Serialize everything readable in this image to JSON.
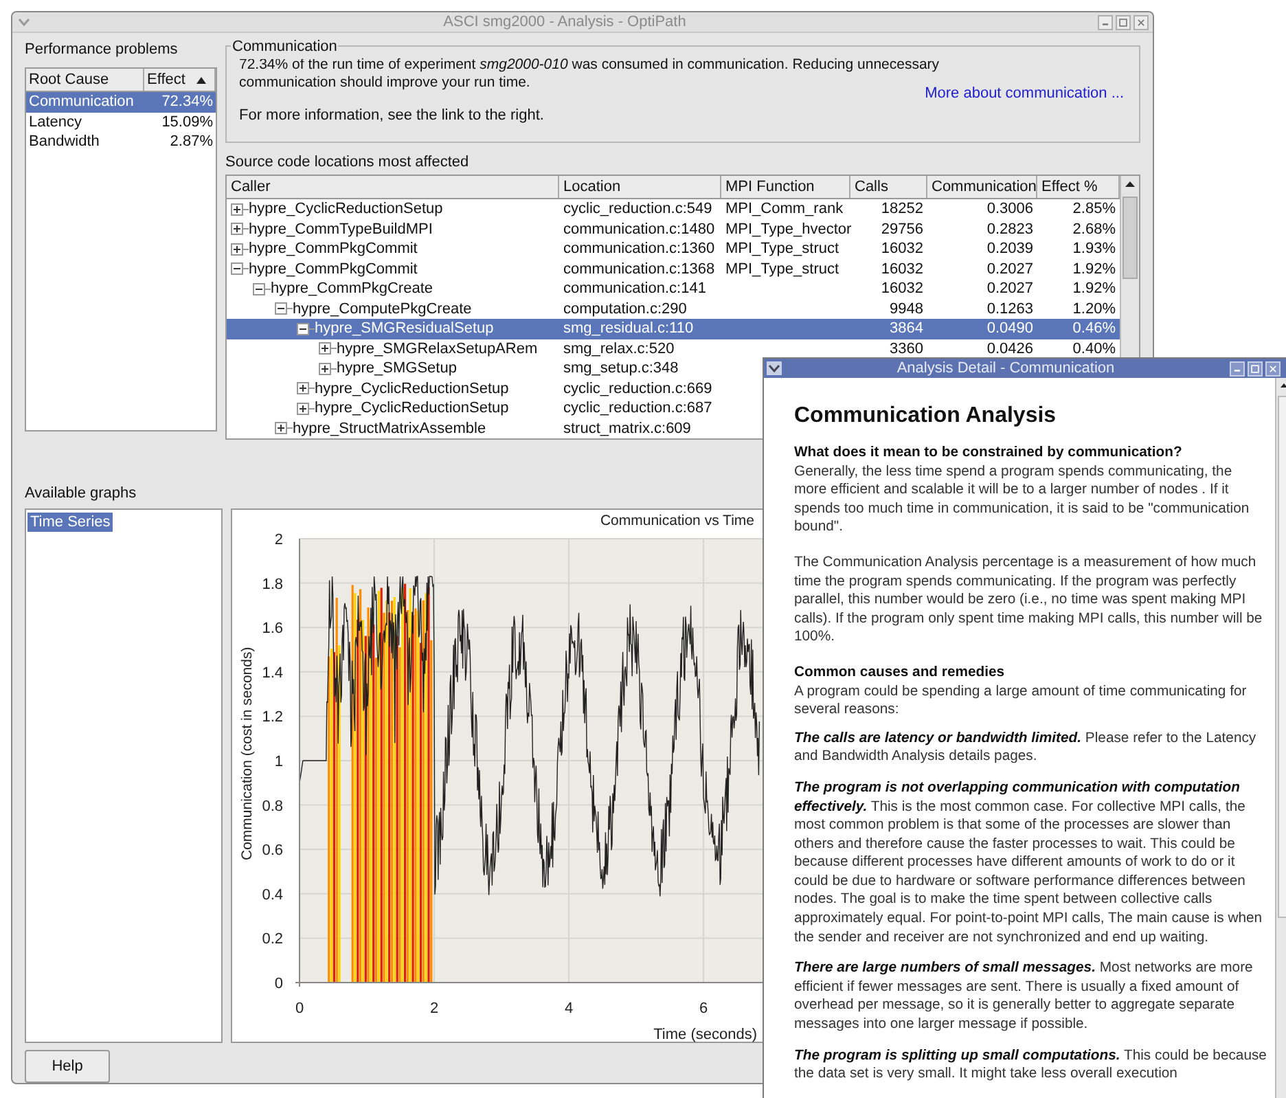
{
  "window": {
    "title": "ASCI smg2000 - Analysis - OptiPath"
  },
  "problems": {
    "title": "Performance problems",
    "columns": [
      {
        "label": "Root Cause",
        "sorted": false
      },
      {
        "label": "Effect",
        "sorted": true
      }
    ],
    "rows": [
      {
        "cause": "Communication",
        "effect": "72.34%",
        "selected": true
      },
      {
        "cause": "Latency",
        "effect": "15.09%",
        "selected": false
      },
      {
        "cause": "Bandwidth",
        "effect": "2.87%",
        "selected": false
      }
    ]
  },
  "summary": {
    "title": "Communication",
    "text": "72.34% of the run time of experiment *smg2000-010* was consumed in communication. Reducing unnecessary communication should improve your run time.",
    "note": "For more information, see the link to the right.",
    "link": "More about communication ..."
  },
  "locations": {
    "title": "Source code locations most affected",
    "columns": [
      "Caller",
      "Location",
      "MPI Function",
      "Calls",
      "Communication",
      "Effect %"
    ],
    "rows": [
      {
        "caller": "hypre_CyclicReductionSetup",
        "location": "cyclic_reduction.c:549",
        "mpi_function": "MPI_Comm_rank",
        "calls": "18252",
        "communication": "0.3006",
        "effect": "2.85%",
        "expanded": false,
        "selected": false
      },
      {
        "caller": "hypre_CommTypeBuildMPI",
        "location": "communication.c:1480",
        "mpi_function": "MPI_Type_hvector",
        "calls": "29756",
        "communication": "0.2823",
        "effect": "2.68%",
        "expanded": false,
        "selected": false
      },
      {
        "caller": "hypre_CommPkgCommit",
        "location": "communication.c:1360",
        "mpi_function": "MPI_Type_struct",
        "calls": "16032",
        "communication": "0.2039",
        "effect": "1.93%",
        "expanded": false,
        "selected": false
      },
      {
        "caller": "hypre_CommPkgCommit",
        "location": "communication.c:1368",
        "mpi_function": "MPI_Type_struct",
        "calls": "16032",
        "communication": "0.2027",
        "effect": "1.92%",
        "expanded": true,
        "selected": false,
        "children": [
          {
            "caller": "hypre_CommPkgCreate",
            "location": "communication.c:141",
            "calls": "16032",
            "communication": "0.2027",
            "effect": "1.92%",
            "expanded": true,
            "selected": false,
            "children": [
              {
                "caller": "hypre_ComputePkgCreate",
                "location": "computation.c:290",
                "calls": "9948",
                "communication": "0.1263",
                "effect": "1.20%",
                "expanded": true,
                "selected": false,
                "children": [
                  {
                    "caller": "hypre_SMGResidualSetup",
                    "location": "smg_residual.c:110",
                    "calls": "3864",
                    "communication": "0.0490",
                    "effect": "0.46%",
                    "expanded": true,
                    "selected": true,
                    "children": [
                      {
                        "caller": "hypre_SMGRelaxSetupARem",
                        "location": "smg_relax.c:520",
                        "calls": "3360",
                        "communication": "0.0426",
                        "effect": "0.40%",
                        "expanded": false,
                        "selected": false
                      },
                      {
                        "caller": "hypre_SMGSetup",
                        "location": "smg_setup.c:348",
                        "expanded": false,
                        "selected": false
                      }
                    ]
                  },
                  {
                    "caller": "hypre_CyclicReductionSetup",
                    "location": "cyclic_reduction.c:669",
                    "expanded": false,
                    "selected": false
                  },
                  {
                    "caller": "hypre_CyclicReductionSetup",
                    "location": "cyclic_reduction.c:687",
                    "expanded": false,
                    "selected": false
                  }
                ]
              },
              {
                "caller": "hypre_StructMatrixAssemble",
                "location": "struct_matrix.c:609",
                "expanded": false,
                "selected": false
              }
            ]
          }
        ]
      }
    ]
  },
  "graphs": {
    "title": "Available graphs",
    "items": [
      {
        "label": "Time Series",
        "selected": true
      }
    ]
  },
  "chart": {
    "title": "Communication vs Time",
    "ylabel": "Communication (cost in seconds)",
    "xlabel": "Time (seconds)",
    "yticks": [
      "2",
      "1.8",
      "1.6",
      "1.4",
      "1.2",
      "1",
      "0.8",
      "0.6",
      "0.4",
      "0.2",
      "0"
    ],
    "xticks": [
      "0",
      "2",
      "4",
      "6"
    ]
  },
  "buttons": [
    {
      "label": "Help"
    }
  ],
  "detail": {
    "title": "Analysis Detail - Communication",
    "heading": "Communication Analysis",
    "blocks": [
      {
        "kind": "topic",
        "heading": "What does it mean to be constrained by communication?",
        "text": "Generally, the less time spend a program spends communicating, the more efficient and scalable it will be to a larger number of nodes . If it spends too much time in communication, it is said to be \"communication bound\"."
      },
      {
        "kind": "plain",
        "text": "The Communication Analysis percentage is a measurement of how much time the program spends communicating. If the program was perfectly parallel, this number would be zero (i.e., no time was spent making MPI calls). If the program only spent time making MPI calls, this number will be 100%."
      },
      {
        "kind": "topic",
        "heading": "Common causes and remedies",
        "text": "A program could be spending a large amount of time communicating for several reasons:"
      },
      {
        "kind": "lead",
        "lead": "The calls are latency or bandwidth limited.",
        "text": "Please refer to the Latency and Bandwidth Analysis details pages."
      },
      {
        "kind": "lead",
        "lead": "The program is not overlapping communication with computation effectively.",
        "text": "This is the most common case. For collective MPI calls, the most common problem is that some of the processes are slower than others and therefore cause the faster processes to wait. This could be because different processes have different amounts of work to do or it could be due to hardware or software performance differences between nodes. The goal is to make the time spent between collective calls approximately equal. For point-to-point MPI calls, The main cause is when the sender and receiver are not synchronized and end up waiting."
      },
      {
        "kind": "lead",
        "lead": "There are large numbers of small messages.",
        "text": "Most networks are more efficient if fewer messages are sent. There is usually a fixed amount of overhead per message, so it is generally better to aggregate separate messages into one larger message if possible."
      },
      {
        "kind": "lead",
        "lead": "The program is splitting up small computations.",
        "text": "This could be because the data set is very small. It might take less overall execution"
      }
    ]
  }
}
